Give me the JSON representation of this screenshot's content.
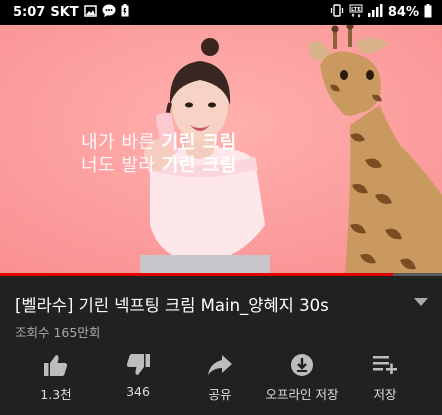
{
  "status_bar": {
    "time": "5:07",
    "carrier": "SKT",
    "battery": "84%",
    "icons": [
      "image-icon",
      "chat-icon",
      "battery-saver-icon",
      "vibrate-icon",
      "lte-icon",
      "signal-icon",
      "battery-icon"
    ]
  },
  "video": {
    "ad_line1_light": "내가 바른 ",
    "ad_line1_bold": "기린 크림",
    "ad_line2_light": "너도 발라 ",
    "ad_line2_bold": "기린 크림",
    "progress": 0.89,
    "background_color": "#fd9a9b"
  },
  "info": {
    "title": "[벨라수] 기린 넥프팅 크림 Main_양혜지 30s",
    "views": "조회수 165만회"
  },
  "actions": {
    "like": "1.3천",
    "dislike": "346",
    "share": "공유",
    "offline": "오프라인 저장",
    "save": "저장"
  },
  "colors": {
    "background": "#212121",
    "progress_red": "#e00000"
  }
}
